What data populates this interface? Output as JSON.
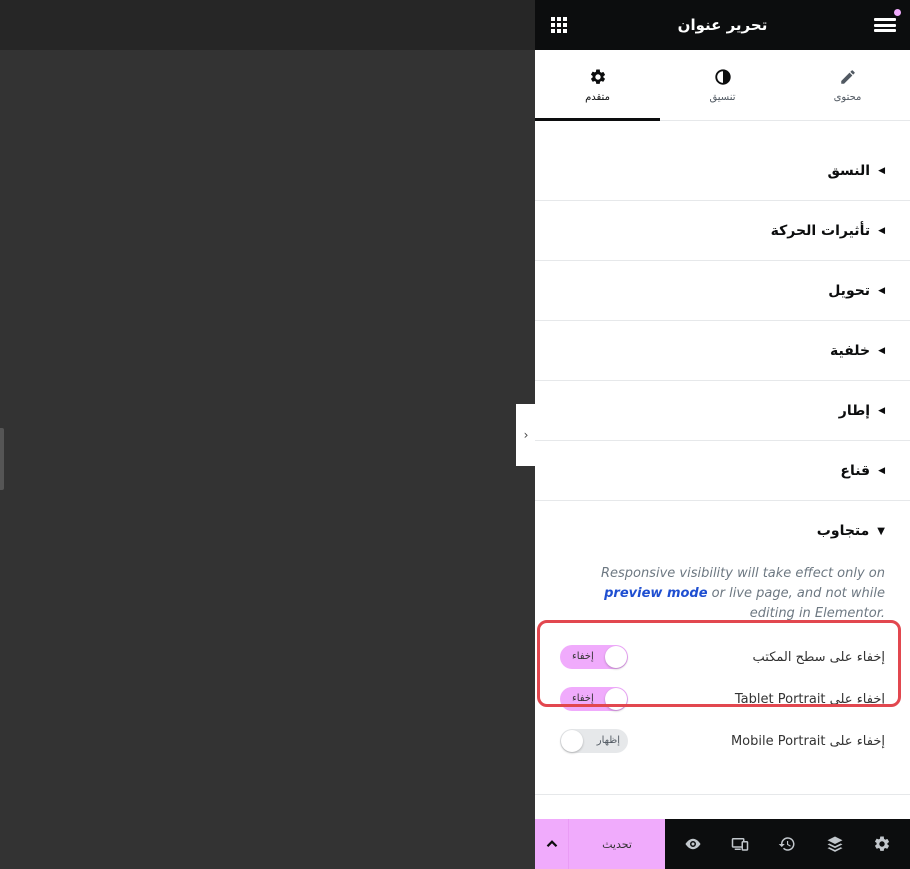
{
  "header": {
    "title": "تحرير عنوان",
    "menu_icon": "hamburger-icon",
    "apps_icon": "grid-icon"
  },
  "tabs": [
    {
      "label": "محتوى",
      "icon": "pencil-icon",
      "active": false
    },
    {
      "label": "تنسيق",
      "icon": "half-circle-icon",
      "active": false
    },
    {
      "label": "متقدم",
      "icon": "gear-icon",
      "active": true
    }
  ],
  "sections": [
    {
      "title": "النسق"
    },
    {
      "title": "تأثيرات الحركة"
    },
    {
      "title": "تحويل"
    },
    {
      "title": "خلفية"
    },
    {
      "title": "إطار"
    },
    {
      "title": "قناع"
    }
  ],
  "responsive": {
    "title": "متجاوب",
    "note_before": "Responsive visibility will take effect only on ",
    "note_link": "preview mode",
    "note_after": " or live page, and not while editing in Elementor.",
    "controls": [
      {
        "label": "إخفاء على سطح المكتب",
        "toggle_text": "إخفاء",
        "state": "on"
      },
      {
        "label": "إخفاء على Tablet Portrait",
        "toggle_text": "إخفاء",
        "state": "on"
      },
      {
        "label": "إخفاء على Mobile Portrait",
        "toggle_text": "إظهار",
        "state": "off"
      }
    ]
  },
  "footer": {
    "update_label": "تحديث",
    "icons": [
      "settings-icon",
      "layers-icon",
      "history-icon",
      "responsive-icon",
      "eye-icon"
    ]
  },
  "colors": {
    "accent": "#f0abfc",
    "highlight": "#e2474f",
    "header_bg": "#0c0d0e",
    "canvas_bg": "#333333"
  }
}
